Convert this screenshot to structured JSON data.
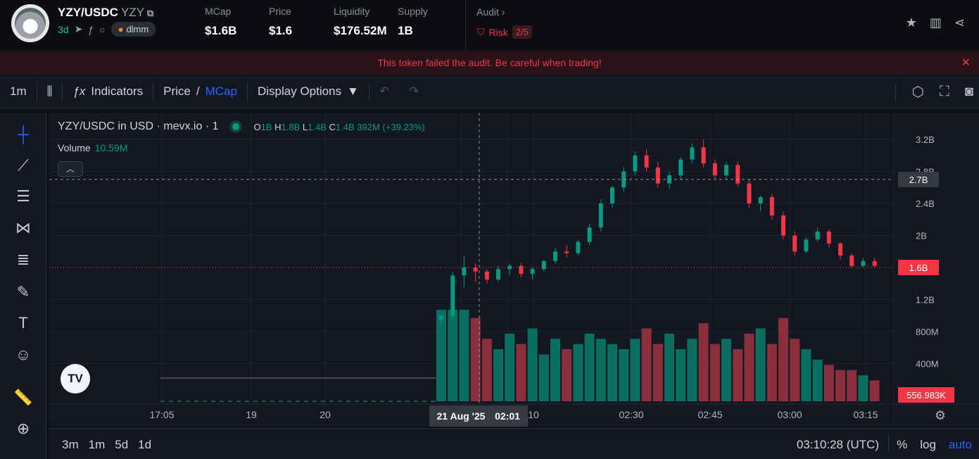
{
  "header": {
    "pair": "YZY/USDC",
    "symbol": "YZY",
    "age": "3d",
    "dex_badge": "dlmm",
    "stats": [
      {
        "label": "MCap",
        "value": "$1.6B"
      },
      {
        "label": "Price",
        "value": "$1.6"
      },
      {
        "label": "Liquidity",
        "value": "$176.52M"
      },
      {
        "label": "Supply",
        "value": "1B"
      }
    ],
    "audit_label": "Audit",
    "risk_label": "Risk",
    "risk_count": "2/5"
  },
  "warning": "This token failed the audit. Be careful when trading!",
  "toolbar": {
    "interval": "1m",
    "indicators": "Indicators",
    "price": "Price",
    "slash": "/",
    "mcap": "MCap",
    "display_options": "Display Options"
  },
  "legend": {
    "title": "YZY/USDC in USD · mevx.io · 1",
    "o_label": "O",
    "o_val": "1B",
    "h_label": "H",
    "h_val": "1.8B",
    "l_label": "L",
    "l_val": "1.4B",
    "c_label": "C",
    "c_val": "1.4B",
    "change": "392M (+39.23%)",
    "volume_label": "Volume",
    "volume_val": "10.59M"
  },
  "tv_logo": "TV",
  "bottom": {
    "ranges": [
      "3m",
      "1m",
      "5d",
      "1d"
    ],
    "clock": "03:10:28 (UTC)",
    "percent": "%",
    "log": "log",
    "auto": "auto"
  },
  "chart_data": {
    "type": "candlestick",
    "y_axis_ticks": [
      "3.2B",
      "2.8B",
      "2.4B",
      "2B",
      "1.6B",
      "1.2B",
      "800M",
      "400M"
    ],
    "x_axis_ticks": [
      "17:05",
      "19",
      "20",
      "21 Aug '25",
      "02:01",
      "10",
      "02:30",
      "02:45",
      "03:00",
      "03:15"
    ],
    "crosshair_price_label": "2.7B",
    "current_price_label": "1.6B",
    "volume_label": "556.983K",
    "candles": [
      [
        0.95,
        1.0,
        0.9,
        1.0
      ],
      [
        1.0,
        1.55,
        0.95,
        1.5
      ],
      [
        1.5,
        1.75,
        1.35,
        1.6
      ],
      [
        1.6,
        1.65,
        1.42,
        1.55
      ],
      [
        1.55,
        1.58,
        1.4,
        1.45
      ],
      [
        1.45,
        1.62,
        1.42,
        1.58
      ],
      [
        1.58,
        1.65,
        1.5,
        1.62
      ],
      [
        1.62,
        1.66,
        1.48,
        1.52
      ],
      [
        1.52,
        1.6,
        1.45,
        1.58
      ],
      [
        1.58,
        1.7,
        1.55,
        1.68
      ],
      [
        1.68,
        1.85,
        1.65,
        1.8
      ],
      [
        1.8,
        1.88,
        1.72,
        1.78
      ],
      [
        1.78,
        1.95,
        1.75,
        1.92
      ],
      [
        1.92,
        2.15,
        1.88,
        2.1
      ],
      [
        2.1,
        2.45,
        2.05,
        2.4
      ],
      [
        2.4,
        2.62,
        2.35,
        2.6
      ],
      [
        2.6,
        2.85,
        2.55,
        2.8
      ],
      [
        2.8,
        3.05,
        2.75,
        3.0
      ],
      [
        3.0,
        3.08,
        2.8,
        2.85
      ],
      [
        2.85,
        2.92,
        2.6,
        2.65
      ],
      [
        2.65,
        2.8,
        2.58,
        2.75
      ],
      [
        2.75,
        2.98,
        2.7,
        2.95
      ],
      [
        2.95,
        3.15,
        2.9,
        3.1
      ],
      [
        3.1,
        3.2,
        2.85,
        2.9
      ],
      [
        2.9,
        2.95,
        2.7,
        2.75
      ],
      [
        2.75,
        2.92,
        2.7,
        2.88
      ],
      [
        2.88,
        2.92,
        2.62,
        2.65
      ],
      [
        2.65,
        2.7,
        2.35,
        2.4
      ],
      [
        2.4,
        2.5,
        2.3,
        2.48
      ],
      [
        2.48,
        2.52,
        2.2,
        2.25
      ],
      [
        2.25,
        2.3,
        1.95,
        2.0
      ],
      [
        2.0,
        2.05,
        1.75,
        1.8
      ],
      [
        1.8,
        1.98,
        1.78,
        1.95
      ],
      [
        1.95,
        2.1,
        1.92,
        2.05
      ],
      [
        2.05,
        2.08,
        1.85,
        1.9
      ],
      [
        1.9,
        1.92,
        1.7,
        1.75
      ],
      [
        1.75,
        1.78,
        1.6,
        1.62
      ],
      [
        1.62,
        1.72,
        1.6,
        1.68
      ],
      [
        1.68,
        1.72,
        1.6,
        1.62
      ]
    ],
    "volumes": [
      5.5,
      4.5,
      2.2,
      1.6,
      1.2,
      1.0,
      1.3,
      1.1,
      1.4,
      0.9,
      1.2,
      1.0,
      1.1,
      1.3,
      1.2,
      1.1,
      1.0,
      1.2,
      1.4,
      1.1,
      1.3,
      1.0,
      1.2,
      1.5,
      1.1,
      1.2,
      1.0,
      1.3,
      1.4,
      1.1,
      1.6,
      1.2,
      1.0,
      0.8,
      0.7,
      0.6,
      0.6,
      0.5,
      0.4
    ]
  }
}
